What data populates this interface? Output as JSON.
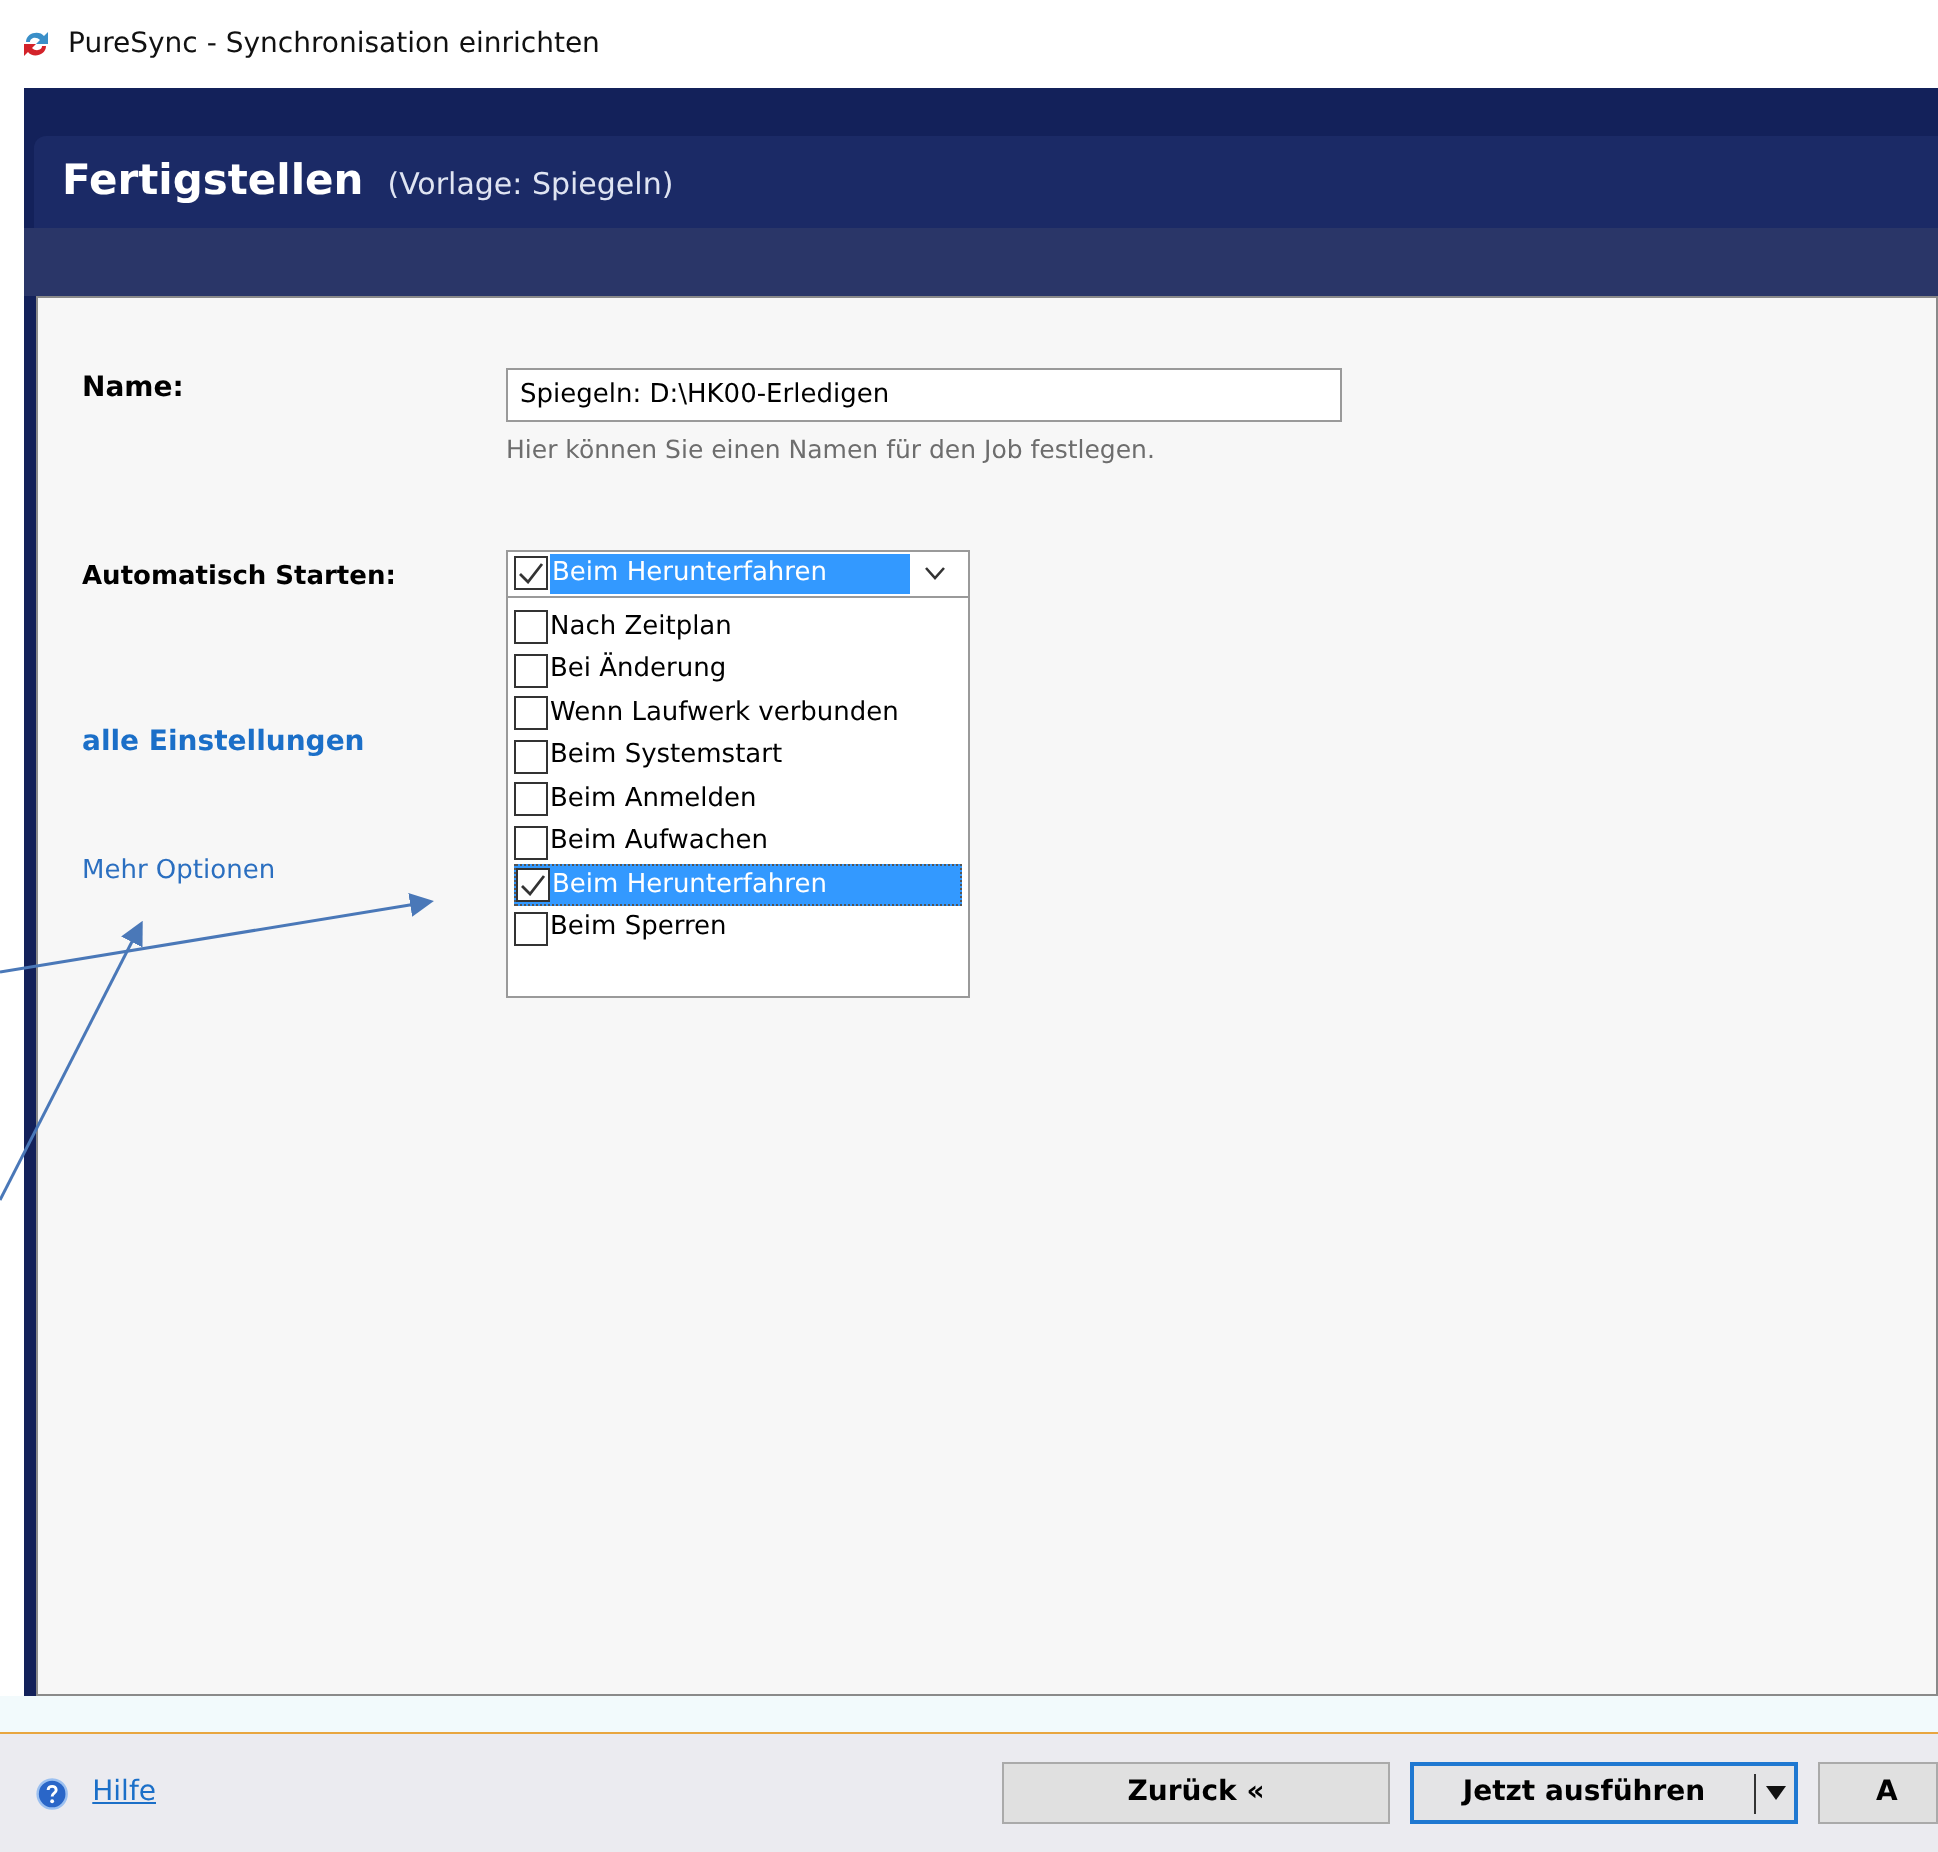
{
  "window": {
    "title": "PureSync - Synchronisation einrichten"
  },
  "header": {
    "title": "Fertigstellen",
    "subtitle": "(Vorlage: Spiegeln)"
  },
  "name_field": {
    "label": "Name:",
    "value": "Spiegeln: D:\\HK00-Erledigen",
    "hint": "Hier können Sie einen Namen für den Job festlegen."
  },
  "autostart": {
    "label": "Automatisch Starten:",
    "value": "Beim Herunterfahren",
    "value_checked": true,
    "expanded": true,
    "options": [
      {
        "label": "Nach Zeitplan",
        "checked": false,
        "selected": false
      },
      {
        "label": "Bei Änderung",
        "checked": false,
        "selected": false
      },
      {
        "label": "Wenn Laufwerk verbunden",
        "checked": false,
        "selected": false
      },
      {
        "label": "Beim Systemstart",
        "checked": false,
        "selected": false
      },
      {
        "label": "Beim Anmelden",
        "checked": false,
        "selected": false
      },
      {
        "label": "Beim Aufwachen",
        "checked": false,
        "selected": false
      },
      {
        "label": "Beim Herunterfahren",
        "checked": true,
        "selected": true
      },
      {
        "label": "Beim Sperren",
        "checked": false,
        "selected": false
      }
    ]
  },
  "links": [
    {
      "label": "alle Einstellungen",
      "kind": "bold"
    },
    {
      "label": "Mehr Optionen",
      "kind": "plain"
    }
  ],
  "footer": {
    "help": "Hilfe",
    "buttons": [
      {
        "label": "Zurück «",
        "kind": "plain"
      },
      {
        "label": "Jetzt ausführen",
        "kind": "split"
      },
      {
        "label": "A",
        "kind": "plain"
      }
    ]
  }
}
